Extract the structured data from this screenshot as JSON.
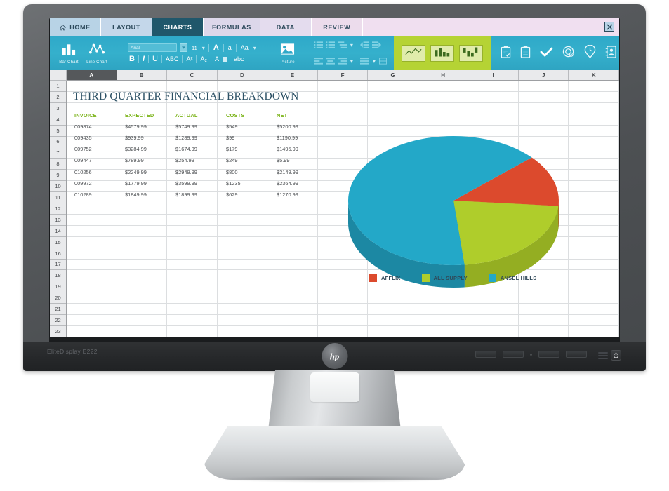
{
  "monitor": {
    "model_label": "EliteDisplay E222",
    "brand": "hp",
    "osd_button_count": 4,
    "power_icon": "power-icon"
  },
  "app": {
    "tabs": [
      {
        "id": "home",
        "label": "HOME",
        "icon": "home-icon",
        "active": false
      },
      {
        "id": "layout",
        "label": "LAYOUT",
        "active": false
      },
      {
        "id": "charts",
        "label": "CHARTS",
        "active": true
      },
      {
        "id": "formulas",
        "label": "FORMULAS",
        "active": false
      },
      {
        "id": "data",
        "label": "DATA",
        "active": false
      },
      {
        "id": "review",
        "label": "REVIEW",
        "active": false
      }
    ],
    "close_label": "✕",
    "ribbon": {
      "chart_buttons": [
        {
          "id": "bar-chart",
          "label": "Bar Chart",
          "icon": "bar-chart-icon"
        },
        {
          "id": "line-chart",
          "label": "Line Chart",
          "icon": "line-chart-icon"
        }
      ],
      "font": {
        "name": "Arial",
        "size": "11",
        "dropdown_caret": "▾",
        "grow_label": "A",
        "shrink_label": "a",
        "case_label": "Aa",
        "bold_label": "B",
        "italic_label": "I",
        "underline_label": "U",
        "strikethrough_label": "ABC",
        "superscript_label": "A²",
        "subscript_label": "A₂",
        "font_color_label": "A",
        "clear_format_label": "abc"
      },
      "picture": {
        "id": "picture",
        "label": "Picture",
        "icon": "picture-icon"
      },
      "insert_charts": [
        {
          "id": "insert-line-chart",
          "icon": "line-chart-preview-icon"
        },
        {
          "id": "insert-column-chart",
          "icon": "column-chart-preview-icon"
        },
        {
          "id": "insert-stacked-chart",
          "icon": "stacked-chart-preview-icon"
        }
      ],
      "tool_icons": [
        {
          "id": "clipboard-check",
          "icon": "clipboard-check-icon"
        },
        {
          "id": "clipboard-list",
          "icon": "clipboard-list-icon"
        },
        {
          "id": "check",
          "icon": "check-icon"
        },
        {
          "id": "target",
          "icon": "target-icon"
        },
        {
          "id": "clock-pin",
          "icon": "clock-pin-icon"
        },
        {
          "id": "contact-book",
          "icon": "contact-book-icon"
        }
      ]
    },
    "grid": {
      "columns": [
        "A",
        "B",
        "C",
        "D",
        "E",
        "F",
        "G",
        "H",
        "I",
        "J",
        "K"
      ],
      "selected_column": "A",
      "rows": [
        "1",
        "2",
        "3",
        "4",
        "5",
        "6",
        "7",
        "8",
        "9",
        "10",
        "11",
        "12",
        "13",
        "14",
        "15",
        "16",
        "17",
        "18",
        "19",
        "20",
        "21",
        "22",
        "23"
      ]
    },
    "sheet": {
      "title": "THIRD QUARTER FINANCIAL BREAKDOWN",
      "headers": [
        "INVOICE",
        "EXPECTED",
        "ACTUAL",
        "COSTS",
        "NET"
      ],
      "rows": [
        [
          "009874",
          "$4579.99",
          "$5749.99",
          "$549",
          "$5200.99"
        ],
        [
          "009435",
          "$939.99",
          "$1289.99",
          "$99",
          "$1190.99"
        ],
        [
          "009752",
          "$3284.99",
          "$1674.99",
          "$179",
          "$1495.99"
        ],
        [
          "009447",
          "$789.99",
          "$254.99",
          "$249",
          "$5.99"
        ],
        [
          "010256",
          "$2249.99",
          "$2949.99",
          "$800",
          "$2149.99"
        ],
        [
          "009972",
          "$1779.99",
          "$3599.99",
          "$1235",
          "$2364.99"
        ],
        [
          "010289",
          "$1849.99",
          "$1899.99",
          "$629",
          "$1270.99"
        ]
      ]
    },
    "colors": {
      "ribbon_blue": "#2fa9c9",
      "active_tab": "#20576b",
      "tab_blue": "#b8d3e6",
      "chart_group_green": "#b5d334",
      "header_green": "#7ab317",
      "title_slate": "#2e5266"
    }
  },
  "chart_data": {
    "type": "pie",
    "title": "",
    "three_d": true,
    "legend_position": "bottom",
    "categories": [
      "AFFLIX",
      "ALL SUPPLY",
      "ANSEL HILLS"
    ],
    "values": [
      13,
      22,
      65
    ],
    "colors": [
      "#dc4a2d",
      "#afcd2b",
      "#23a8c8"
    ],
    "side_colors": [
      "#b93c24",
      "#94ae22",
      "#1c88a3"
    ],
    "start_angle": -42,
    "legend": [
      {
        "label": "AFFLIX",
        "color": "#dc4a2d"
      },
      {
        "label": "ALL SUPPLY",
        "color": "#afcd2b"
      },
      {
        "label": "ANSEL HILLS",
        "color": "#23a8c8"
      }
    ]
  }
}
